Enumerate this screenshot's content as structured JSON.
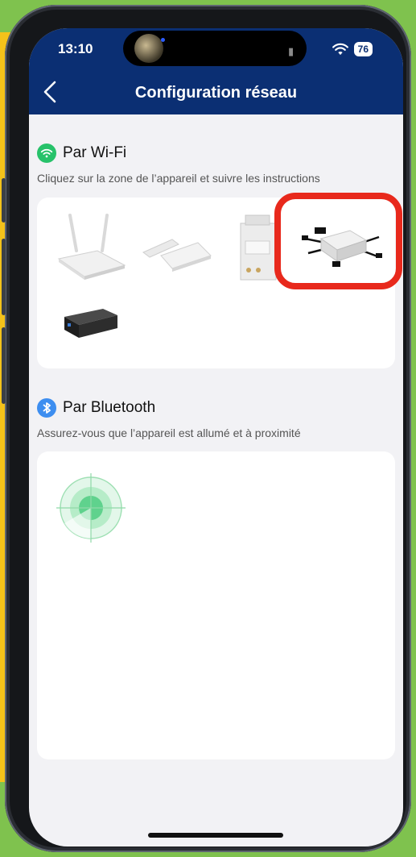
{
  "status_bar": {
    "time": "13:10",
    "battery": "76"
  },
  "nav": {
    "title": "Configuration réseau",
    "back_icon": "chevron-left-icon"
  },
  "wifi_section": {
    "title": "Par Wi-Fi",
    "subtitle": "Cliquez sur la zone de l’appareil et suivre les instructions",
    "icon": "wifi-icon",
    "icon_color": "#27c26a",
    "devices": [
      "router",
      "wifi-stick",
      "din-rail-meter",
      "microinverter",
      "battery-gateway"
    ],
    "selected_device": "microinverter",
    "highlight_color": "#e8291c"
  },
  "bluetooth_section": {
    "title": "Par Bluetooth",
    "subtitle": "Assurez-vous que l’appareil est allumé et à proximité",
    "icon": "bluetooth-icon",
    "icon_color": "#3d8ef0",
    "scanner_icon": "radar-scan-icon"
  },
  "colors": {
    "header": "#0b2f73",
    "background": "#f2f2f5"
  }
}
